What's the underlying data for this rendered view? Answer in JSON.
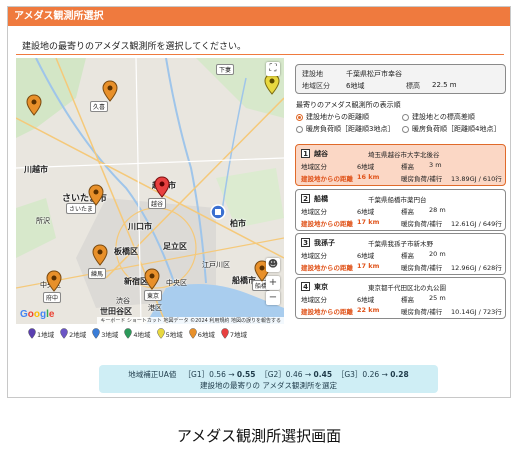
{
  "window": {
    "title": "アメダス観測所選択"
  },
  "instruction": "建設地の最寄りのアメダス観測所を選択してください。",
  "map": {
    "labels": {
      "kuki": "久喜",
      "shimotsuma": "下妻",
      "kawagoe": "川越市",
      "saitama_city": "さいたま市",
      "koshigaya": "越谷市",
      "kashiwa": "柏市",
      "kawaguchi": "川口市",
      "itabashi": "板橋区",
      "adachi": "足立区",
      "shinjuku": "新宿区",
      "funabashi": "船橋市",
      "chuo": "中央区",
      "setagaya": "世田谷区",
      "shibuya": "渋谷",
      "tokorozawa": "所沢",
      "kumagaya_badge": "熊谷",
      "saitama_badge": "さいたま",
      "koshigaya_badge": "越谷",
      "tokyo_badge": "東京",
      "fuchu_badge": "府中",
      "nerima_badge": "練馬",
      "funabashi_badge": "船橋",
      "minato": "港区",
      "edogawa": "江戸川区"
    },
    "google": "Google",
    "attribution": "キーボード ショートカット  地図データ ©2024  利用規約  地図の誤りを報告する"
  },
  "legend": [
    {
      "label": "1地域",
      "color": "#5a3fb0"
    },
    {
      "label": "2地域",
      "color": "#6b55c6"
    },
    {
      "label": "3地域",
      "color": "#3a7dd8"
    },
    {
      "label": "4地域",
      "color": "#2c9a5a"
    },
    {
      "label": "5地域",
      "color": "#e8d840"
    },
    {
      "label": "6地域",
      "color": "#e8902a"
    },
    {
      "label": "7地域",
      "color": "#e84040"
    }
  ],
  "site": {
    "label_name": "建設地",
    "name": "千葉県松戸市幸谷",
    "label_region": "地域区分",
    "region": "6地域",
    "label_elev": "標高",
    "elev": "22.5 m"
  },
  "filter": {
    "title": "最寄りのアメダス観測所の表示順",
    "options": [
      {
        "label": "建設地からの距離順",
        "selected": true
      },
      {
        "label": "建設地との標高差順",
        "selected": false
      },
      {
        "label": "暖房負荷順［距離順3地点］",
        "selected": false
      },
      {
        "label": "暖房負荷順［距離順4地点］",
        "selected": false
      }
    ]
  },
  "candidates": [
    {
      "num": "1",
      "name": "越谷",
      "addr": "埼玉県越谷市大字北後谷",
      "region_label": "地域区分",
      "region": "6地域",
      "elev_label": "標高",
      "elev": "3 m",
      "dist_label": "建設地からの距離",
      "dist": "16 km",
      "load_label": "暖房負荷/補行",
      "load": "13.89GJ / 610行",
      "selected": true
    },
    {
      "num": "2",
      "name": "船橋",
      "addr": "千葉県船橋市薬円台",
      "region_label": "地域区分",
      "region": "6地域",
      "elev_label": "標高",
      "elev": "28 m",
      "dist_label": "建設地からの距離",
      "dist": "17 km",
      "load_label": "暖房負荷/補行",
      "load": "12.61GJ / 649行",
      "selected": false
    },
    {
      "num": "3",
      "name": "我孫子",
      "addr": "千葉県我孫子市新木野",
      "region_label": "地域区分",
      "region": "6地域",
      "elev_label": "標高",
      "elev": "20 m",
      "dist_label": "建設地からの距離",
      "dist": "17 km",
      "load_label": "暖房負荷/補行",
      "load": "12.96GJ / 628行",
      "selected": false
    },
    {
      "num": "4",
      "name": "東京",
      "addr": "東京都千代田区北の丸公園",
      "region_label": "地域区分",
      "region": "6地域",
      "elev_label": "標高",
      "elev": "25 m",
      "dist_label": "建設地からの距離",
      "dist": "22 km",
      "load_label": "暖房負荷/補行",
      "load": "10.14GJ / 723行",
      "selected": false
    }
  ],
  "result": {
    "prefix": "地域補正UA値",
    "g1": "［G1］0.56 →",
    "g1v": "0.55",
    "g2": "［G2］0.46 →",
    "g2v": "0.45",
    "g3": "［G3］0.26 →",
    "g3v": "0.28",
    "line2": "建設地の最寄りの アメダス観測所を選定"
  },
  "caption": "アメダス観測所選択画面"
}
